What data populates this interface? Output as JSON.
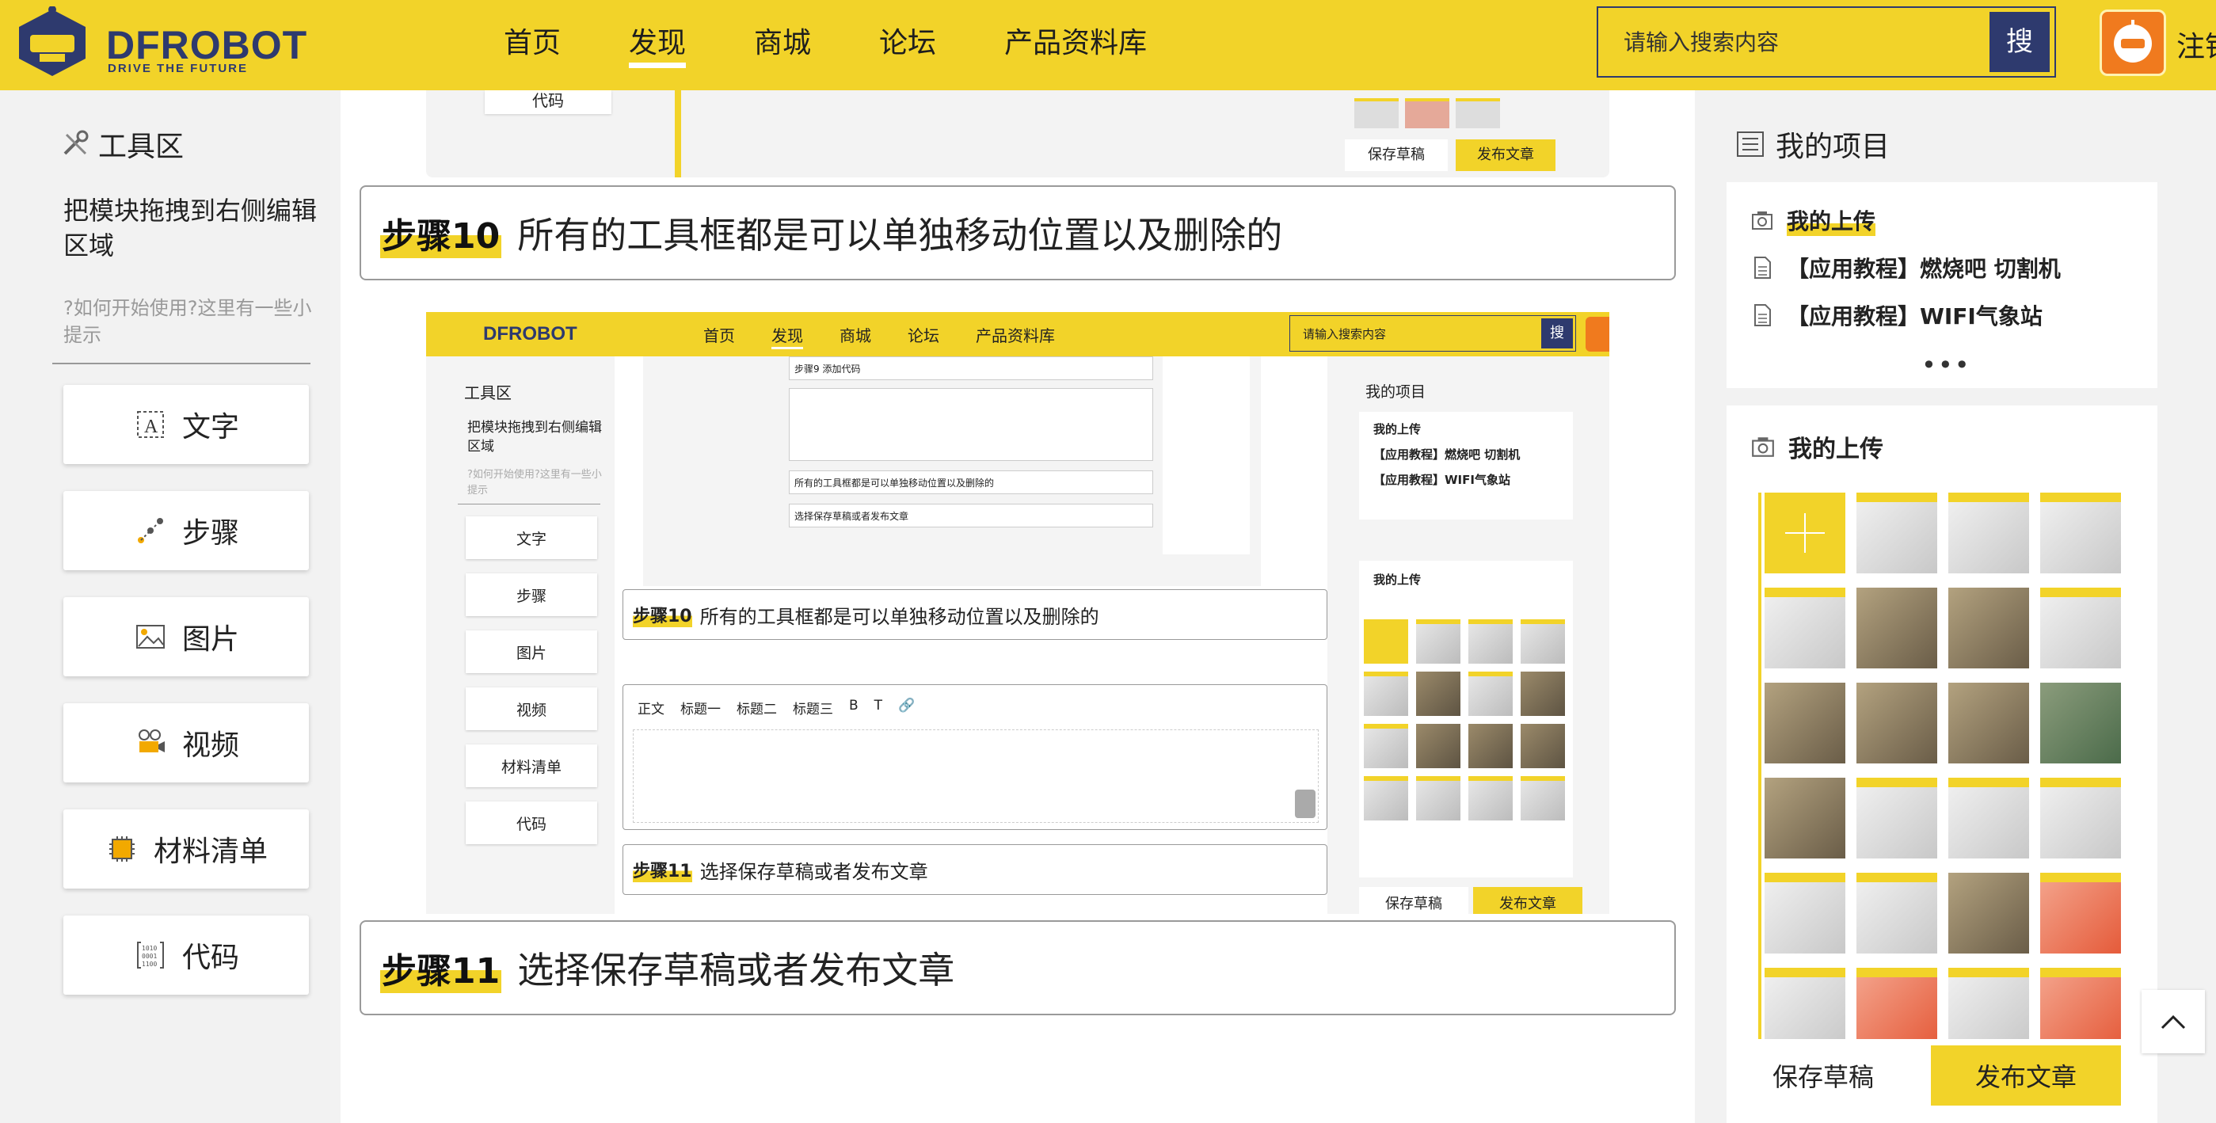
{
  "header": {
    "logo_text": "DFROBOT",
    "logo_tagline": "DRIVE THE FUTURE",
    "nav": [
      "首页",
      "发现",
      "商城",
      "论坛",
      "产品资料库"
    ],
    "active_nav": "发现",
    "search_placeholder": "请输入搜索内容",
    "search_button": "搜",
    "login": "注销"
  },
  "left_panel": {
    "title": "工具区",
    "tip": "把模块拖拽到右侧编辑区域",
    "hint": "?如何开始使用?这里有一些小提示",
    "tools": [
      {
        "label": "文字",
        "icon": "text-icon"
      },
      {
        "label": "步骤",
        "icon": "steps-icon"
      },
      {
        "label": "图片",
        "icon": "image-icon"
      },
      {
        "label": "视频",
        "icon": "video-icon"
      },
      {
        "label": "材料清单",
        "icon": "chip-icon"
      },
      {
        "label": "代码",
        "icon": "code-icon"
      }
    ]
  },
  "main": {
    "prev_snippet_code": "代码",
    "prev_snippet_save": "保存草稿",
    "prev_snippet_publish": "发布文章",
    "step10": {
      "label": "步骤10",
      "text": "所有的工具框都是可以单独移动位置以及删除的"
    },
    "step11": {
      "label": "步骤11",
      "text": "选择保存草稿或者发布文章"
    },
    "embedded_screenshot": {
      "nav": [
        "首页",
        "发现",
        "商城",
        "论坛",
        "产品资料库"
      ],
      "search_placeholder": "请输入搜索内容",
      "search_button": "搜",
      "tool_title": "工具区",
      "tip": "把模块拖拽到右侧编辑区域",
      "hint": "?如何开始使用?这里有一些小提示",
      "tools": [
        "文字",
        "步骤",
        "图片",
        "视频",
        "材料清单",
        "代码"
      ],
      "mini_step9": "步骤9 添加代码",
      "step10": {
        "label": "步骤10",
        "text": "所有的工具框都是可以单独移动位置以及删除的"
      },
      "step11": {
        "label": "步骤11",
        "text": "选择保存草稿或者发布文章"
      },
      "toolbar": [
        "正文",
        "标题一",
        "标题二",
        "标题三",
        "B",
        "T"
      ],
      "project_title": "我的项目",
      "project_items": [
        "我的上传",
        "【应用教程】燃烧吧 切割机",
        "【应用教程】WIFI气象站"
      ],
      "upload_title": "我的上传",
      "save": "保存草稿",
      "publish": "发布文章"
    }
  },
  "right_panel": {
    "title": "我的项目",
    "project_items": [
      {
        "label": "我的上传",
        "icon": "camera-icon"
      },
      {
        "label": "【应用教程】燃烧吧 切割机",
        "icon": "document-icon"
      },
      {
        "label": "【应用教程】WIFI气象站",
        "icon": "document-icon"
      }
    ],
    "more": "•••",
    "upload_title": "我的上传",
    "save_button": "保存草稿",
    "publish_button": "发布文章"
  },
  "colors": {
    "brand_yellow": "#f2d329",
    "brand_navy": "#2e3a6e",
    "avatar_orange": "#f07a1e"
  }
}
